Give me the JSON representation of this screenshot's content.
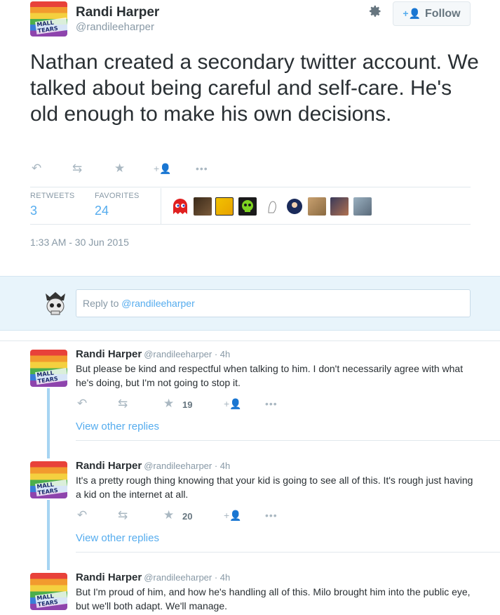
{
  "tweet": {
    "author_name": "Randi Harper",
    "author_handle": "@randileeharper",
    "avatar_tag": "MALL TEARS",
    "follow_label": "Follow",
    "text": "Nathan created a secondary twitter account. We talked about being careful and self-care. He's old enough to make his own decisions.",
    "retweets_label": "RETWEETS",
    "retweets_count": "3",
    "favorites_label": "FAVORITES",
    "favorites_count": "24",
    "timestamp": "1:33 AM - 30 Jun 2015"
  },
  "reply_box": {
    "prefix": "Reply to ",
    "mention": "@randileeharper"
  },
  "replies": [
    {
      "name": "Randi Harper",
      "handle_time": "@randileeharper · 4h",
      "text": "But please be kind and respectful when talking to him. I don't necessarily agree with what he's doing, but I'm not going to stop it.",
      "favorites": "19",
      "link": "View other replies"
    },
    {
      "name": "Randi Harper",
      "handle_time": "@randileeharper · 4h",
      "text": "It's a pretty rough thing knowing that your kid is going to see all of this. It's rough just having a kid on the internet at all.",
      "favorites": "20",
      "link": "View other replies"
    },
    {
      "name": "Randi Harper",
      "handle_time": "@randileeharper · 4h",
      "text": "But I'm proud of him, and how he's handling all of this. Milo brought him into the public eye, but we'll both adapt. We'll manage."
    }
  ],
  "icons": {
    "reply": "reply-icon",
    "retweet": "retweet-icon",
    "favorite": "star-icon",
    "follow": "add-user-icon",
    "more": "more-icon",
    "settings": "gear-icon"
  },
  "colors": {
    "link": "#55acee",
    "muted": "#8899a6",
    "text": "#292f33",
    "reply_bg": "#e8f4fb",
    "thread_line": "#a6d4f2"
  }
}
